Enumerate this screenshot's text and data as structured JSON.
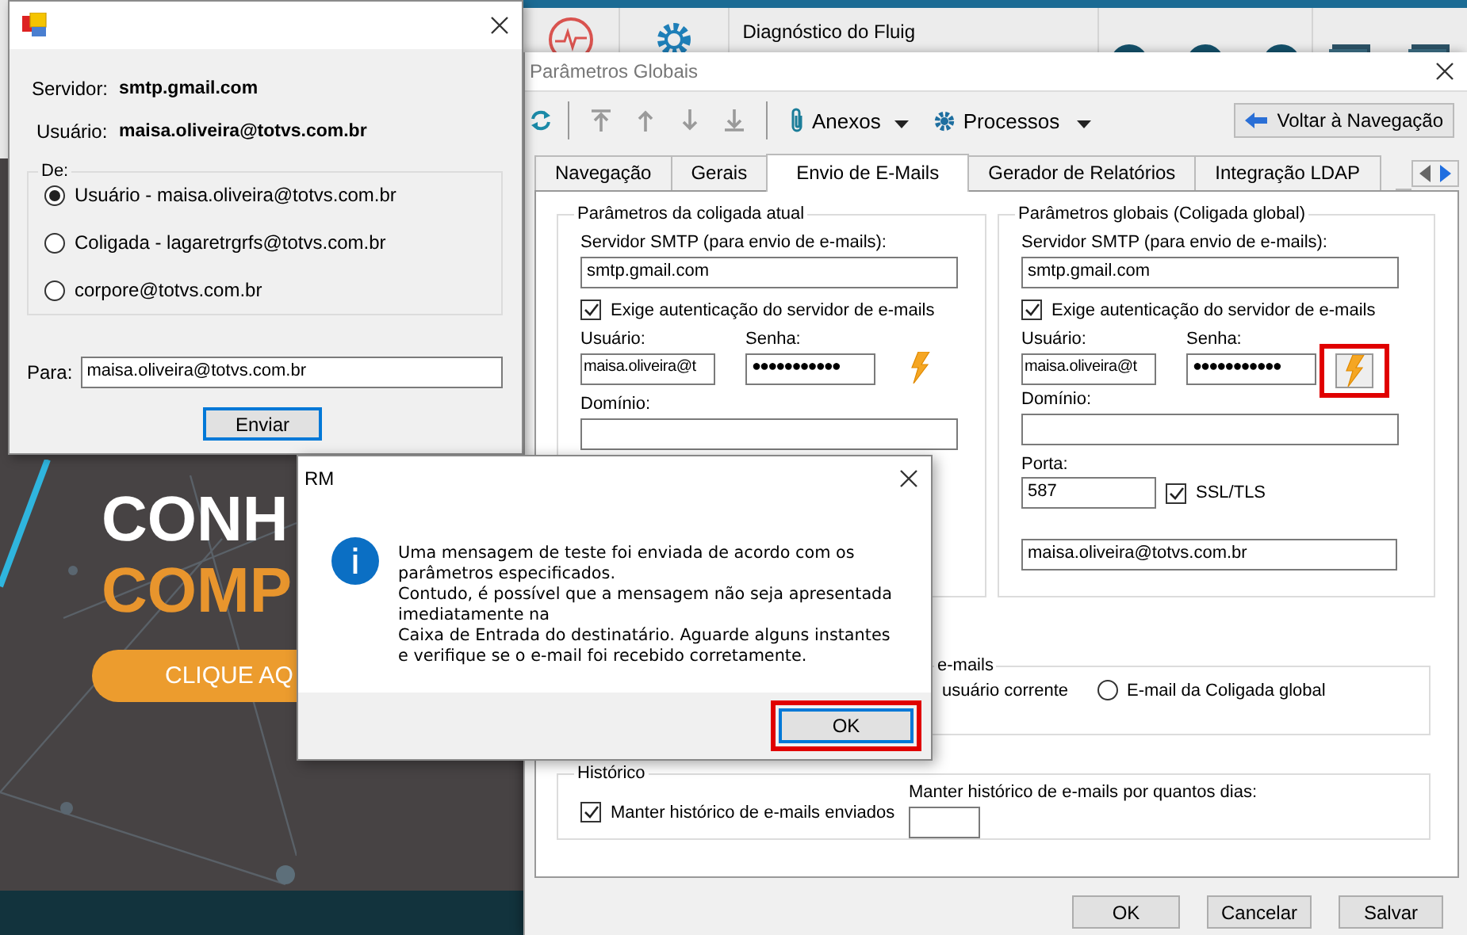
{
  "background": {
    "app_toolbar": {
      "title": "Diagnóstico do Fluig"
    },
    "banner": {
      "headline": "CONH",
      "subheadline": "COMP",
      "button": "CLIQUE AQ"
    }
  },
  "main_window": {
    "title": "Parâmetros Globais",
    "toolbar": {
      "menus": [
        "Anexos",
        "Processos"
      ],
      "back_button": "Voltar à Navegação"
    },
    "tabs": [
      {
        "label": "Navegação",
        "selected": false
      },
      {
        "label": "Gerais",
        "selected": false
      },
      {
        "label": "Envio de E-Mails",
        "selected": true
      },
      {
        "label": "Gerador de Relatórios",
        "selected": false
      },
      {
        "label": "Integração LDAP",
        "selected": false
      }
    ],
    "groups": [
      {
        "title": "Parâmetros da coligada atual",
        "smtp_label": "Servidor SMTP (para envio de e-mails):",
        "smtp_value": "smtp.gmail.com",
        "auth": {
          "label": "Exige autenticação do servidor de e-mails",
          "checked": true
        },
        "user_label": "Usuário:",
        "user_value": "maisa.oliveira@t",
        "password_label": "Senha:",
        "password_value": "●●●●●●●●●●●",
        "test_button": {
          "highlighted": false
        },
        "domain_label": "Domínio:"
      },
      {
        "title": "Parâmetros globais (Coligada global)",
        "smtp_label": "Servidor SMTP (para envio de e-mails):",
        "smtp_value": "smtp.gmail.com",
        "auth": {
          "label": "Exige autenticação do servidor de e-mails",
          "checked": true
        },
        "user_label": "Usuário:",
        "user_value": "maisa.oliveira@t",
        "password_label": "Senha:",
        "password_value": "●●●●●●●●●●●",
        "test_button": {
          "highlighted": true
        },
        "domain_label": "Domínio:",
        "port": {
          "label": "Porta:",
          "value": "587"
        },
        "ssl": {
          "label": "SSL/TLS",
          "checked": true
        },
        "email_value": "maisa.oliveira@totvs.com.br"
      }
    ],
    "sender_group": {
      "title": "e-mails",
      "covered_option": "usuário corrente",
      "options": [
        {
          "label": "E-mail da Coligada global",
          "selected": false
        }
      ]
    },
    "history": {
      "title": "Histórico",
      "keep": {
        "label": "Manter histórico de e-mails enviados",
        "checked": true
      },
      "days_label": "Manter histórico de e-mails por quantos dias:"
    },
    "buttons": [
      "OK",
      "Cancelar",
      "Salvar"
    ]
  },
  "test_dialog": {
    "server": {
      "label": "Servidor:",
      "value": "smtp.gmail.com"
    },
    "user": {
      "label": "Usuário:",
      "value": "maisa.oliveira@totvs.com.br"
    },
    "from": {
      "title": "De:",
      "options": [
        {
          "label": "Usuário - maisa.oliveira@totvs.com.br",
          "selected": true
        },
        {
          "label": "Coligada - lagaretrgrfs@totvs.com.br",
          "selected": false
        },
        {
          "label": "corpore@totvs.com.br",
          "selected": false
        }
      ]
    },
    "to": {
      "label": "Para:",
      "value": "maisa.oliveira@totvs.com.br"
    },
    "send_button": {
      "label": "Enviar",
      "default": true
    }
  },
  "message_box": {
    "title": "RM",
    "message": "Uma mensagem de teste foi enviada de acordo com os\nparâmetros especificados.\nContudo, é possível que a mensagem não seja apresentada\nimediatamente na\nCaixa de Entrada do destinatário. Aguarde alguns instantes\ne verifique se o e-mail foi recebido corretamente.",
    "ok_button": {
      "label": "OK",
      "highlighted": true,
      "default": true
    }
  }
}
